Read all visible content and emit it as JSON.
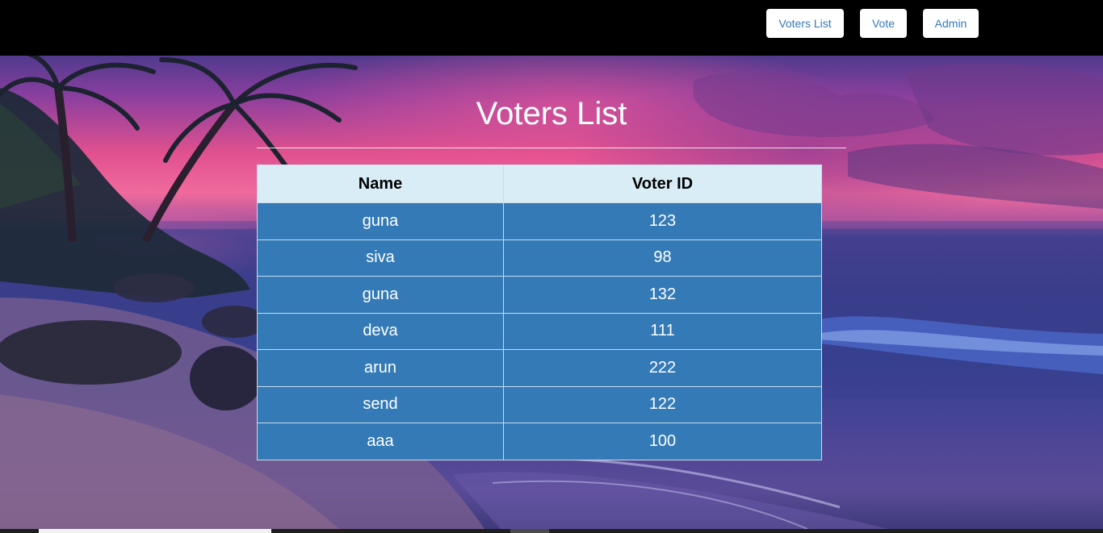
{
  "nav": {
    "voters_list": "Voters List",
    "vote": "Vote",
    "admin": "Admin"
  },
  "page": {
    "title": "Voters List"
  },
  "table": {
    "headers": [
      "Name",
      "Voter ID"
    ],
    "rows": [
      [
        "guna",
        "123"
      ],
      [
        "siva",
        "98"
      ],
      [
        "guna",
        "132"
      ],
      [
        "deva",
        "111"
      ],
      [
        "arun",
        "222"
      ],
      [
        "send",
        "122"
      ],
      [
        "aaa",
        "100"
      ]
    ]
  },
  "colors": {
    "navbar": "#000000",
    "button_text": "#337ab7",
    "header_row": "#d9edf7",
    "body_row": "#337ab7"
  }
}
